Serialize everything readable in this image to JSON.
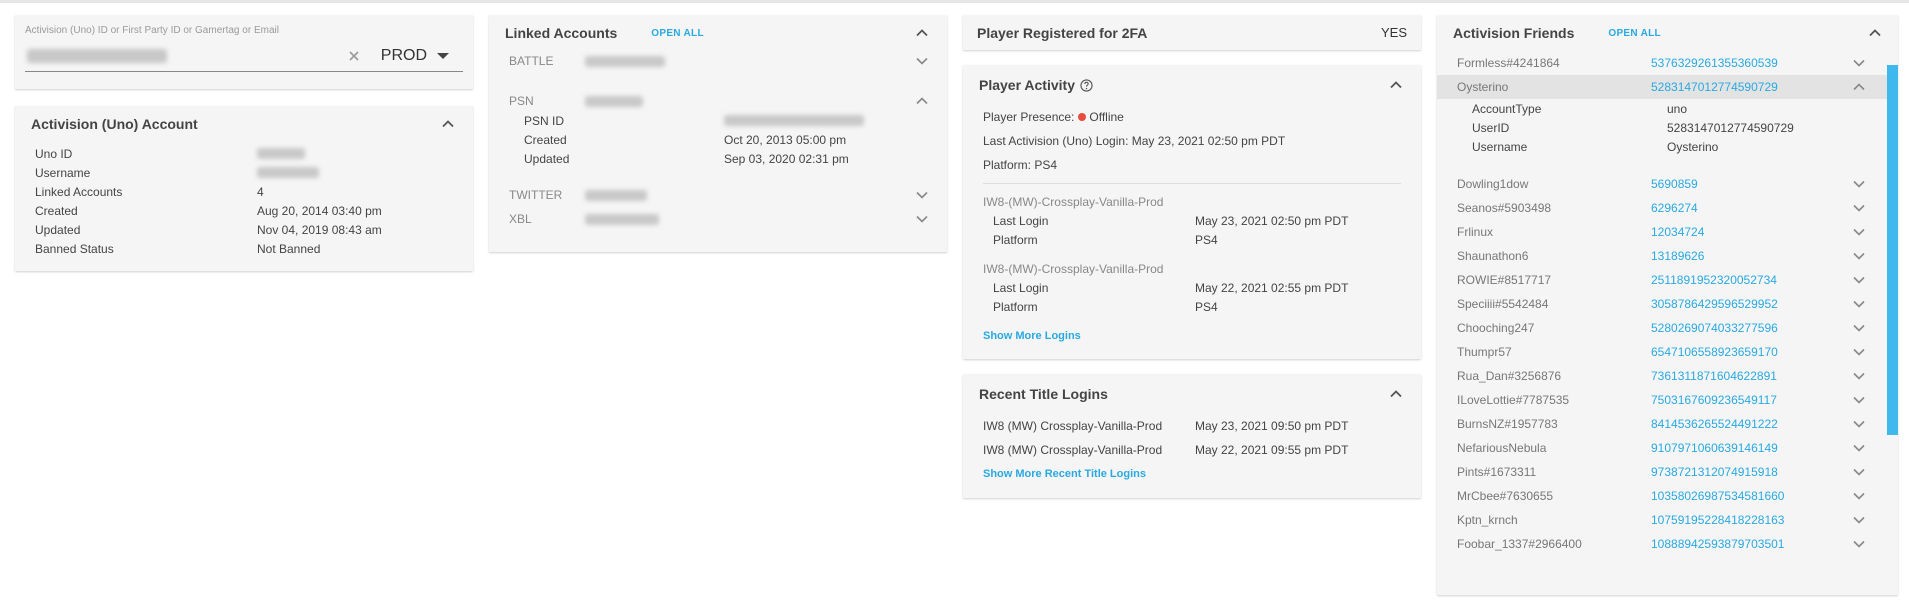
{
  "search": {
    "label": "Activision (Uno) ID or First Party ID or Gamertag or Email",
    "env": "PROD"
  },
  "account": {
    "title": "Activision (Uno) Account",
    "rows": [
      {
        "label": "Uno ID",
        "value": ""
      },
      {
        "label": "Username",
        "value": ""
      },
      {
        "label": "Linked Accounts",
        "value": "4"
      },
      {
        "label": "Created",
        "value": "Aug 20, 2014 03:40 pm"
      },
      {
        "label": "Updated",
        "value": "Nov 04, 2019 08:43 am"
      },
      {
        "label": "Banned Status",
        "value": "Not Banned"
      }
    ]
  },
  "linked": {
    "title": "Linked Accounts",
    "open_all": "OPEN ALL",
    "battle": "BATTLE",
    "psn": "PSN",
    "psn_rows": [
      {
        "label": "PSN ID",
        "value": ""
      },
      {
        "label": "Created",
        "value": "Oct 20, 2013 05:00 pm"
      },
      {
        "label": "Updated",
        "value": "Sep 03, 2020 02:31 pm"
      }
    ],
    "twitter": "TWITTER",
    "xbl": "XBL"
  },
  "tfa": {
    "title": "Player Registered for 2FA",
    "value": "YES"
  },
  "activity": {
    "title": "Player Activity",
    "presence_label": "Player Presence:",
    "presence_value": "Offline",
    "last_login_label": "Last Activision (Uno) Login:",
    "last_login_value": "May 23, 2021 02:50 pm PDT",
    "platform_label": "Platform:",
    "platform_value": "PS4",
    "titles": [
      {
        "name": "IW8-(MW)-Crossplay-Vanilla-Prod",
        "last_login_label": "Last Login",
        "last_login": "May 23, 2021 02:50 pm PDT",
        "platform_label": "Platform",
        "platform": "PS4"
      },
      {
        "name": "IW8-(MW)-Crossplay-Vanilla-Prod",
        "last_login_label": "Last Login",
        "last_login": "May 22, 2021 02:55 pm PDT",
        "platform_label": "Platform",
        "platform": "PS4"
      }
    ],
    "more": "Show More Logins"
  },
  "recent": {
    "title": "Recent Title Logins",
    "rows": [
      {
        "title": "IW8 (MW) Crossplay-Vanilla-Prod",
        "time": "May 23, 2021 09:50 pm PDT"
      },
      {
        "title": "IW8 (MW) Crossplay-Vanilla-Prod",
        "time": "May 22, 2021 09:55 pm PDT"
      }
    ],
    "more": "Show More Recent Title Logins"
  },
  "friends": {
    "title": "Activision Friends",
    "open_all": "OPEN ALL",
    "expanded_details": [
      {
        "label": "AccountType",
        "value": "uno"
      },
      {
        "label": "UserID",
        "value": "5283147012774590729"
      },
      {
        "label": "Username",
        "value": "Oysterino"
      }
    ],
    "items": [
      {
        "name": "Formless#4241864",
        "id": "5376329261355360539"
      },
      {
        "name": "Oysterino",
        "id": "5283147012774590729"
      },
      {
        "name": "Dowling1dow",
        "id": "5690859"
      },
      {
        "name": "Seanos#5903498",
        "id": "6296274"
      },
      {
        "name": "Frlinux",
        "id": "12034724"
      },
      {
        "name": "Shaunathon6",
        "id": "13189626"
      },
      {
        "name": "ROWIE#8517717",
        "id": "2511891952320052734"
      },
      {
        "name": "Speciiii#5542484",
        "id": "3058786429596529952"
      },
      {
        "name": "Chooching247",
        "id": "5280269074033277596"
      },
      {
        "name": "Thumpr57",
        "id": "6547106558923659170"
      },
      {
        "name": "Rua_Dan#3256876",
        "id": "7361311871604622891"
      },
      {
        "name": "ILoveLottie#7787535",
        "id": "7503167609236549117"
      },
      {
        "name": "BurnsNZ#1957783",
        "id": "8414536265524491222"
      },
      {
        "name": "NefariousNebula",
        "id": "9107971060639146149"
      },
      {
        "name": "Pints#1673311",
        "id": "9738721312074915918"
      },
      {
        "name": "MrCbee#7630655",
        "id": "10358026987534581660"
      },
      {
        "name": "Kptn_krnch",
        "id": "10759195228418228163"
      },
      {
        "name": "Foobar_1337#2966400",
        "id": "10888942593879703501"
      }
    ]
  },
  "colors": {
    "accent": "#29a9e1",
    "card_bg": "#f5f5f5",
    "offline": "#e74c3c"
  }
}
